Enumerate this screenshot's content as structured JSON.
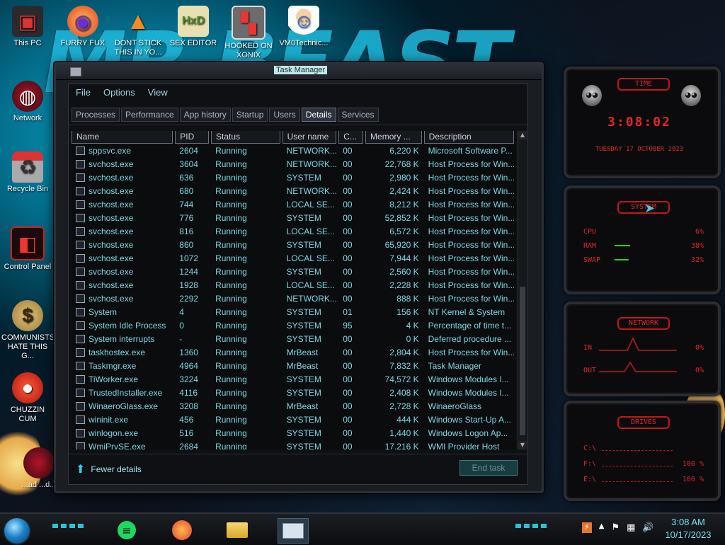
{
  "wallpaper_text": "MR BEAST",
  "desktop_icons": [
    {
      "label": "This PC"
    },
    {
      "label": "FURRY FUX"
    },
    {
      "label": "DONT STICK THIS IN YO..."
    },
    {
      "label": "SEX EDITOR"
    },
    {
      "label": "HOOKED ON XONIX"
    },
    {
      "label": "VM0Technic..."
    },
    {
      "label": "Network"
    },
    {
      "label": "Recycle Bin"
    },
    {
      "label": "Control Panel"
    },
    {
      "label": "COMMUNISTS HATE THIS G..."
    },
    {
      "label": "CHUZZIN CUM"
    },
    {
      "label": "...ad ...d..."
    }
  ],
  "window": {
    "title": "Task Manager",
    "menu": [
      "File",
      "Options",
      "View"
    ],
    "tabs": [
      "Processes",
      "Performance",
      "App history",
      "Startup",
      "Users",
      "Details",
      "Services"
    ],
    "active_tab": "Details",
    "columns": [
      "Name",
      "PID",
      "Status",
      "User name",
      "C...",
      "Memory ...",
      "Description"
    ],
    "rows": [
      {
        "name": "sppsvc.exe",
        "pid": "2604",
        "status": "Running",
        "user": "NETWORK...",
        "cpu": "00",
        "mem": "6,220 K",
        "desc": "Microsoft Software P..."
      },
      {
        "name": "svchost.exe",
        "pid": "3604",
        "status": "Running",
        "user": "NETWORK...",
        "cpu": "00",
        "mem": "22,768 K",
        "desc": "Host Process for Win..."
      },
      {
        "name": "svchost.exe",
        "pid": "636",
        "status": "Running",
        "user": "SYSTEM",
        "cpu": "00",
        "mem": "2,980 K",
        "desc": "Host Process for Win..."
      },
      {
        "name": "svchost.exe",
        "pid": "680",
        "status": "Running",
        "user": "NETWORK...",
        "cpu": "00",
        "mem": "2,424 K",
        "desc": "Host Process for Win..."
      },
      {
        "name": "svchost.exe",
        "pid": "744",
        "status": "Running",
        "user": "LOCAL SE...",
        "cpu": "00",
        "mem": "8,212 K",
        "desc": "Host Process for Win..."
      },
      {
        "name": "svchost.exe",
        "pid": "776",
        "status": "Running",
        "user": "SYSTEM",
        "cpu": "00",
        "mem": "52,852 K",
        "desc": "Host Process for Win..."
      },
      {
        "name": "svchost.exe",
        "pid": "816",
        "status": "Running",
        "user": "LOCAL SE...",
        "cpu": "00",
        "mem": "6,572 K",
        "desc": "Host Process for Win..."
      },
      {
        "name": "svchost.exe",
        "pid": "860",
        "status": "Running",
        "user": "SYSTEM",
        "cpu": "00",
        "mem": "65,920 K",
        "desc": "Host Process for Win..."
      },
      {
        "name": "svchost.exe",
        "pid": "1072",
        "status": "Running",
        "user": "LOCAL SE...",
        "cpu": "00",
        "mem": "7,944 K",
        "desc": "Host Process for Win..."
      },
      {
        "name": "svchost.exe",
        "pid": "1244",
        "status": "Running",
        "user": "SYSTEM",
        "cpu": "00",
        "mem": "2,560 K",
        "desc": "Host Process for Win..."
      },
      {
        "name": "svchost.exe",
        "pid": "1928",
        "status": "Running",
        "user": "LOCAL SE...",
        "cpu": "00",
        "mem": "2,228 K",
        "desc": "Host Process for Win..."
      },
      {
        "name": "svchost.exe",
        "pid": "2292",
        "status": "Running",
        "user": "NETWORK...",
        "cpu": "00",
        "mem": "888 K",
        "desc": "Host Process for Win..."
      },
      {
        "name": "System",
        "pid": "4",
        "status": "Running",
        "user": "SYSTEM",
        "cpu": "01",
        "mem": "156 K",
        "desc": "NT Kernel & System"
      },
      {
        "name": "System Idle Process",
        "pid": "0",
        "status": "Running",
        "user": "SYSTEM",
        "cpu": "95",
        "mem": "4 K",
        "desc": "Percentage of time t..."
      },
      {
        "name": "System interrupts",
        "pid": "-",
        "status": "Running",
        "user": "SYSTEM",
        "cpu": "00",
        "mem": "0 K",
        "desc": "Deferred procedure ..."
      },
      {
        "name": "taskhostex.exe",
        "pid": "1360",
        "status": "Running",
        "user": "MrBeast",
        "cpu": "00",
        "mem": "2,804 K",
        "desc": "Host Process for Win..."
      },
      {
        "name": "Taskmgr.exe",
        "pid": "4964",
        "status": "Running",
        "user": "MrBeast",
        "cpu": "00",
        "mem": "7,832 K",
        "desc": "Task Manager"
      },
      {
        "name": "TiWorker.exe",
        "pid": "3224",
        "status": "Running",
        "user": "SYSTEM",
        "cpu": "00",
        "mem": "74,572 K",
        "desc": "Windows Modules I..."
      },
      {
        "name": "TrustedInstaller.exe",
        "pid": "4116",
        "status": "Running",
        "user": "SYSTEM",
        "cpu": "00",
        "mem": "2,408 K",
        "desc": "Windows Modules I..."
      },
      {
        "name": "WinaeroGlass.exe",
        "pid": "3208",
        "status": "Running",
        "user": "MrBeast",
        "cpu": "00",
        "mem": "2,728 K",
        "desc": "WinaeroGlass"
      },
      {
        "name": "wininit.exe",
        "pid": "456",
        "status": "Running",
        "user": "SYSTEM",
        "cpu": "00",
        "mem": "444 K",
        "desc": "Windows Start-Up A..."
      },
      {
        "name": "winlogon.exe",
        "pid": "516",
        "status": "Running",
        "user": "SYSTEM",
        "cpu": "00",
        "mem": "1,440 K",
        "desc": "Windows Logon Ap..."
      },
      {
        "name": "WmiPrvSE.exe",
        "pid": "2684",
        "status": "Running",
        "user": "SYSTEM",
        "cpu": "00",
        "mem": "17,216 K",
        "desc": "WMI Provider Host"
      }
    ],
    "fewer_details": "Fewer details",
    "end_task": "End task"
  },
  "gadgets": {
    "time": {
      "title": "TIME",
      "clock": "3:08:02",
      "date": "TUESDAY 17 OCTOBER 2023"
    },
    "system": {
      "title": "SYSTEM",
      "cpu_label": "CPU",
      "cpu_value": "6%",
      "ram_label": "RAM",
      "ram_value": "38%",
      "swap_label": "SWAP",
      "swap_value": "32%"
    },
    "network": {
      "title": "NETWORK",
      "in_label": "IN",
      "in_value": "0%",
      "out_label": "OUT",
      "out_value": "0%"
    },
    "drives": {
      "title": "DRIVES",
      "c_label": "C:\\",
      "f_label": "F:\\",
      "f_value": "100 %",
      "e_label": "E:\\",
      "e_value": "100 %"
    }
  },
  "taskbar": {
    "time": "3:08 AM",
    "date": "10/17/2023"
  },
  "colors": {
    "accent": "#27d4e6",
    "gadget_red": "#e2262a",
    "text_cyan": "#7ad9e4"
  }
}
